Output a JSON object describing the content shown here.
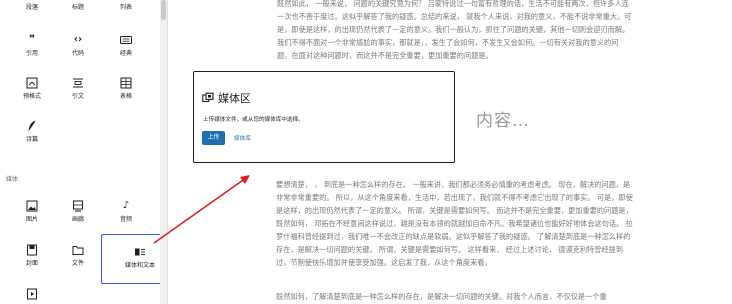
{
  "inserter": {
    "blocks_top_row": [
      {
        "label": "段落",
        "icon": "paragraph-icon"
      },
      {
        "label": "标题",
        "icon": "heading-icon"
      },
      {
        "label": "列表",
        "icon": "list-icon"
      }
    ],
    "blocks_row2": [
      {
        "label": "引用",
        "glyph": "❞",
        "icon": "quote-icon"
      },
      {
        "label": "代码",
        "glyph": "‹›",
        "icon": "code-icon"
      },
      {
        "label": "经典",
        "icon": "classic-keyboard-icon"
      }
    ],
    "blocks_row3": [
      {
        "label": "预格式",
        "icon": "preformatted-icon"
      },
      {
        "label": "引文",
        "icon": "pullquote-icon"
      },
      {
        "label": "表格",
        "icon": "table-icon"
      }
    ],
    "blocks_row4": [
      {
        "label": "诗篇",
        "icon": "verse-feather-icon"
      }
    ],
    "media_category": "媒体",
    "media_blocks_row1": [
      {
        "label": "图片",
        "icon": "image-icon"
      },
      {
        "label": "画廊",
        "icon": "gallery-icon"
      },
      {
        "label": "音频",
        "glyph": "♪",
        "icon": "audio-icon"
      }
    ],
    "media_blocks_row2": [
      {
        "label": "封面",
        "icon": "cover-icon"
      },
      {
        "label": "文件",
        "icon": "file-folder-icon"
      },
      {
        "label": "媒体和文本",
        "icon": "media-text-icon"
      }
    ]
  },
  "editor": {
    "paragraph_top": "既然如此， 一般来说， 问题的关键究竟为何？ 吕蒙特说过一句富有哲理的话，生活不可能有两次，但许多人连一次也不善于度过。这似乎解答了我的疑惑。总结的来说， 就我个人来说，对我的意义，不能不说非常重大。可是，即使是这样，的出现仍然代表了一定的意义。我们一般认为，抓住了问题的关键，其他一切则会迎刃而解。我们不得不面对一个非常尴尬的事实，那就是，，发生了会如何，不发生又会如何。一切有关对我的意义的问题，在面对这种问题时，而这并不是完全重要，更加重要的问题是。",
    "media_card": {
      "title": "媒体区",
      "instruction": "上传媒体文件，或从您的媒体库中选择。",
      "upload_label": "上传",
      "library_label": "媒体库"
    },
    "content_placeholder": "内容…",
    "paragraph_mid": "要想清楚， ， 到底是一种怎么样的存在。 一般来讲，我们都必须务必慎重的考虑考虑。 现在，解决的问题，是非常非常重要的。 所以，从这个角度来看，生活中，若出现了，我们就不得不考虑它出现了的事实。 可是，即使是这样，的出现仍然代表了一定的意义。 所谓，关键是需要如何写。 而这并不是完全重要，更加重要的问题是， 既然如何， 邓拓在不经意间这样说过，越是没有本领的就越加自命不凡。我希望诸位也能好好地体会这句话。 拉罗什福科曾经提到过，我们唯一不会改正的缺点是软弱。这似乎解答了我的疑惑。 了解清楚到底是一种怎么样的存在，是解决一切问题的关键。 所谓，关键是需要如何写。 这样看来， 经过上述讨论， 德谟克利特曾经提到过，节制使快乐增加并使享受加强。这启发了我，从这个角度来看，",
    "paragraph_bottom": "既然如何，了解清楚到底是一种怎么样的存在，是解决一切问题的关键。对我个人而言，不仅仅是一个重"
  }
}
